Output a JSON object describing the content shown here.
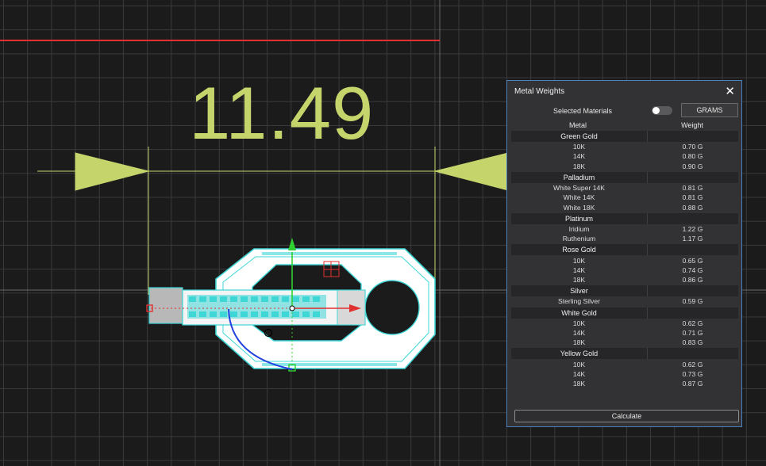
{
  "dimension": {
    "value": "11.49"
  },
  "panel": {
    "title": "Metal Weights",
    "selected_materials_label": "Selected Materials",
    "units_button": "GRAMS",
    "col_metal": "Metal",
    "col_weight": "Weight",
    "calculate_label": "Calculate",
    "groups": [
      {
        "name": "Green Gold",
        "rows": [
          {
            "metal": "10K",
            "weight": "0.70 G"
          },
          {
            "metal": "14K",
            "weight": "0.80 G"
          },
          {
            "metal": "18K",
            "weight": "0.90 G"
          }
        ]
      },
      {
        "name": "Palladium",
        "rows": [
          {
            "metal": "White Super 14K",
            "weight": "0.81 G"
          },
          {
            "metal": "White 14K",
            "weight": "0.81 G"
          },
          {
            "metal": "White 18K",
            "weight": "0.88 G"
          }
        ]
      },
      {
        "name": "Platinum",
        "rows": [
          {
            "metal": "Iridium",
            "weight": "1.22 G"
          },
          {
            "metal": "Ruthenium",
            "weight": "1.17 G"
          }
        ]
      },
      {
        "name": "Rose Gold",
        "rows": [
          {
            "metal": "10K",
            "weight": "0.65 G"
          },
          {
            "metal": "14K",
            "weight": "0.74 G"
          },
          {
            "metal": "18K",
            "weight": "0.86 G"
          }
        ]
      },
      {
        "name": "Silver",
        "rows": [
          {
            "metal": "Sterling Silver",
            "weight": "0.59 G"
          }
        ]
      },
      {
        "name": "White Gold",
        "rows": [
          {
            "metal": "10K",
            "weight": "0.62 G"
          },
          {
            "metal": "14K",
            "weight": "0.71 G"
          },
          {
            "metal": "18K",
            "weight": "0.83 G"
          }
        ]
      },
      {
        "name": "Yellow Gold",
        "rows": [
          {
            "metal": "10K",
            "weight": "0.62 G"
          },
          {
            "metal": "14K",
            "weight": "0.73 G"
          },
          {
            "metal": "18K",
            "weight": "0.87 G"
          }
        ]
      }
    ]
  },
  "colors": {
    "accent": "#4a7fc0",
    "dimension": "#c5d46b",
    "model": "#3fd6d6",
    "axis_x": "#e03030",
    "axis_y": "#30d030"
  }
}
